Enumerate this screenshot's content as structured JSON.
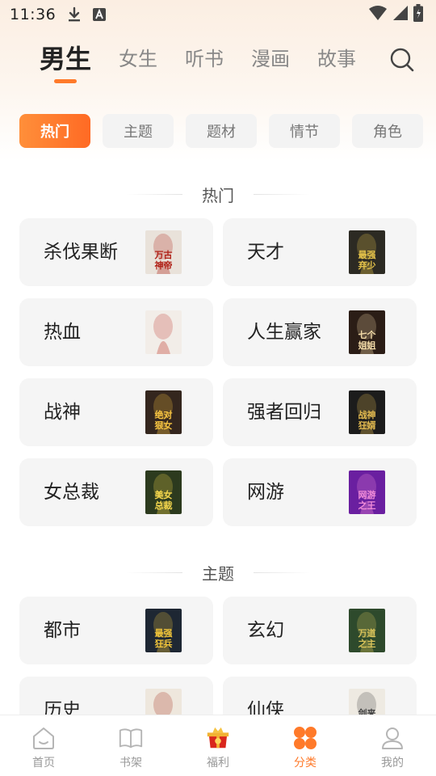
{
  "status_bar": {
    "time": "11:36"
  },
  "nav": {
    "tabs": [
      {
        "label": "男生",
        "active": true
      },
      {
        "label": "女生"
      },
      {
        "label": "听书"
      },
      {
        "label": "漫画"
      },
      {
        "label": "故事"
      }
    ]
  },
  "chips": [
    {
      "label": "热门",
      "active": true
    },
    {
      "label": "主题"
    },
    {
      "label": "题材"
    },
    {
      "label": "情节"
    },
    {
      "label": "角色"
    }
  ],
  "sections": [
    {
      "title": "热门",
      "items": [
        {
          "label": "杀伐果断",
          "cover_text": "万古神帝",
          "cover_colors": [
            "#e9e2da",
            "#b02218"
          ]
        },
        {
          "label": "天才",
          "cover_text": "最强弃少",
          "cover_colors": [
            "#2c2a23",
            "#e5c34a"
          ]
        },
        {
          "label": "热血",
          "cover_text": "",
          "cover_colors": [
            "#f2ede8",
            "#c0392b"
          ]
        },
        {
          "label": "人生赢家",
          "cover_text": "七个姐姐绝代风华",
          "cover_colors": [
            "#2b1d16",
            "#f1d9a6"
          ]
        },
        {
          "label": "战神",
          "cover_text": "绝对狠女齐天殿",
          "cover_colors": [
            "#34261e",
            "#f6c341"
          ]
        },
        {
          "label": "强者回归",
          "cover_text": "战神狂婿",
          "cover_colors": [
            "#1c1c1c",
            "#e0b84f"
          ]
        },
        {
          "label": "女总裁",
          "cover_text": "美女总裁的贴身狂兵",
          "cover_colors": [
            "#2c3a1e",
            "#f4d64d"
          ]
        },
        {
          "label": "网游",
          "cover_text": "网游之王",
          "cover_colors": [
            "#6a1fa0",
            "#f08bd8"
          ]
        }
      ]
    },
    {
      "title": "主题",
      "items": [
        {
          "label": "都市",
          "cover_text": "最强狂兵",
          "cover_colors": [
            "#1e2733",
            "#f0c43a"
          ]
        },
        {
          "label": "玄幻",
          "cover_text": "万道之主",
          "cover_colors": [
            "#2e4a2c",
            "#d9c35a"
          ]
        },
        {
          "label": "历史",
          "cover_text": "",
          "cover_colors": [
            "#eee7dd",
            "#a52a1a"
          ]
        },
        {
          "label": "仙侠",
          "cover_text": "剑来",
          "cover_colors": [
            "#eeeae2",
            "#444444"
          ]
        }
      ]
    }
  ],
  "bottom_nav": [
    {
      "label": "首页",
      "icon": "home-icon"
    },
    {
      "label": "书架",
      "icon": "bookshelf-icon"
    },
    {
      "label": "福利",
      "icon": "gift-icon"
    },
    {
      "label": "分类",
      "icon": "category-icon",
      "active": true
    },
    {
      "label": "我的",
      "icon": "profile-icon"
    }
  ],
  "colors": {
    "accent": "#ff7a2a",
    "card_bg": "#f5f5f5"
  }
}
